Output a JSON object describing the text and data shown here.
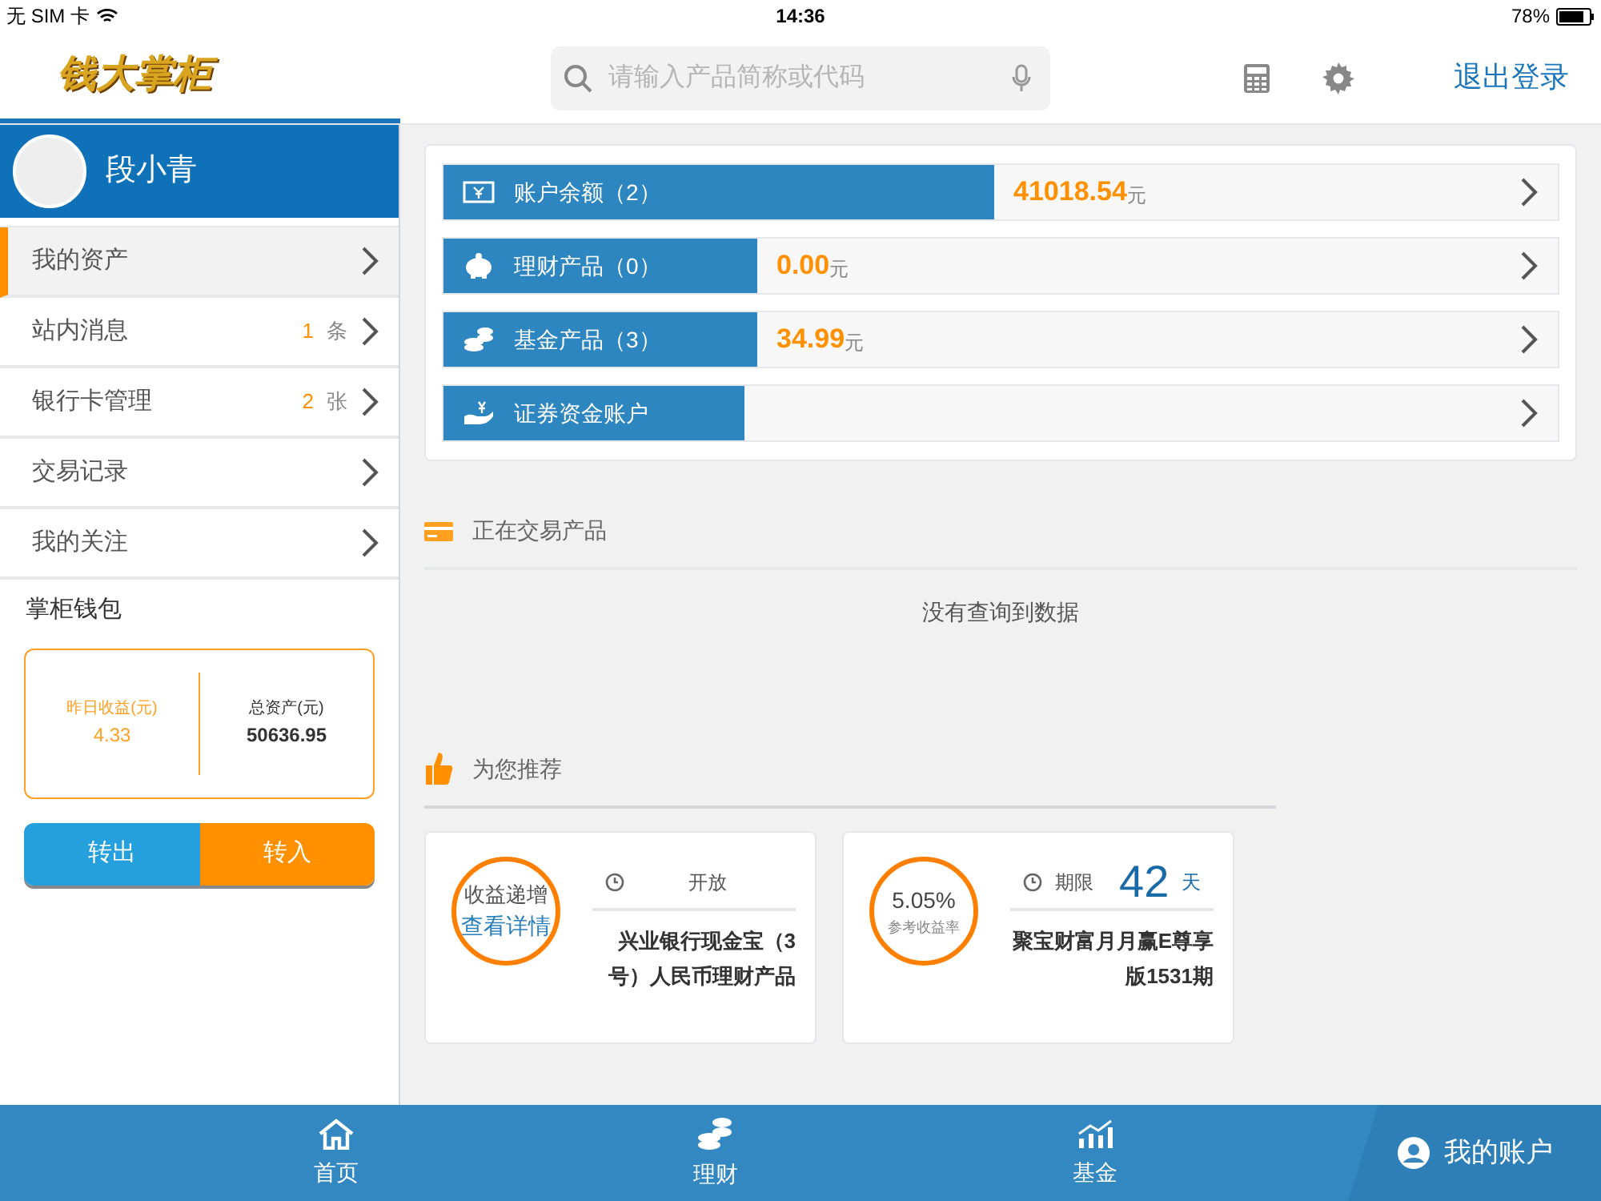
{
  "status_bar": {
    "carrier": "无 SIM 卡",
    "time": "14:36",
    "battery": "78%"
  },
  "header": {
    "logo": "钱大掌柜",
    "search": {
      "placeholder": "请输入产品简称或代码"
    },
    "logout": "退出登录"
  },
  "sidebar": {
    "user_name": "段小青",
    "items": [
      {
        "label": "我的资产",
        "selected": true
      },
      {
        "label": "站内消息",
        "count": "1",
        "unit": "条",
        "selected": false
      },
      {
        "label": "银行卡管理",
        "count": "2",
        "unit": "张",
        "selected": false
      },
      {
        "label": "交易记录",
        "selected": false
      },
      {
        "label": "我的关注",
        "selected": false
      }
    ],
    "wallet": {
      "title": "掌柜钱包",
      "yesterday_label": "昨日收益(元)",
      "yesterday_value": "4.33",
      "total_label": "总资产(元)",
      "total_value": "50636.95",
      "buttons": [
        "转出",
        "转入"
      ]
    }
  },
  "accounts": [
    {
      "kind": "cash",
      "label": "账户余额（2）",
      "amount": "41018.54",
      "unit": "元"
    },
    {
      "kind": "piggy",
      "label": "理财产品（0）",
      "amount": "0.00",
      "unit": "元"
    },
    {
      "kind": "coins",
      "label": "基金产品（3）",
      "amount": "34.99",
      "unit": "元"
    },
    {
      "kind": "hand",
      "label": "证券资金账户"
    }
  ],
  "trading": {
    "title": "正在交易产品",
    "empty": "没有查询到数据"
  },
  "recommend": {
    "title": "为您推荐",
    "cards": [
      {
        "kind": "text",
        "circle_title": "收益递增",
        "circle_link": "查看详情",
        "status": "开放",
        "name": "兴业银行现金宝（3号）人民币理财产品"
      },
      {
        "kind": "rate",
        "rate": "5.05%",
        "rate_label": "参考收益率",
        "term_label": "期限",
        "term": "42",
        "term_unit": "天",
        "name": "聚宝财富月月赢E尊享版1531期"
      }
    ]
  },
  "bottom_nav": [
    {
      "label": "首页",
      "kind": "home",
      "selected": false
    },
    {
      "label": "理财",
      "kind": "coins",
      "selected": false
    },
    {
      "label": "基金",
      "kind": "chart",
      "selected": false
    },
    {
      "label": "我的账户",
      "kind": "user",
      "selected": true
    }
  ]
}
